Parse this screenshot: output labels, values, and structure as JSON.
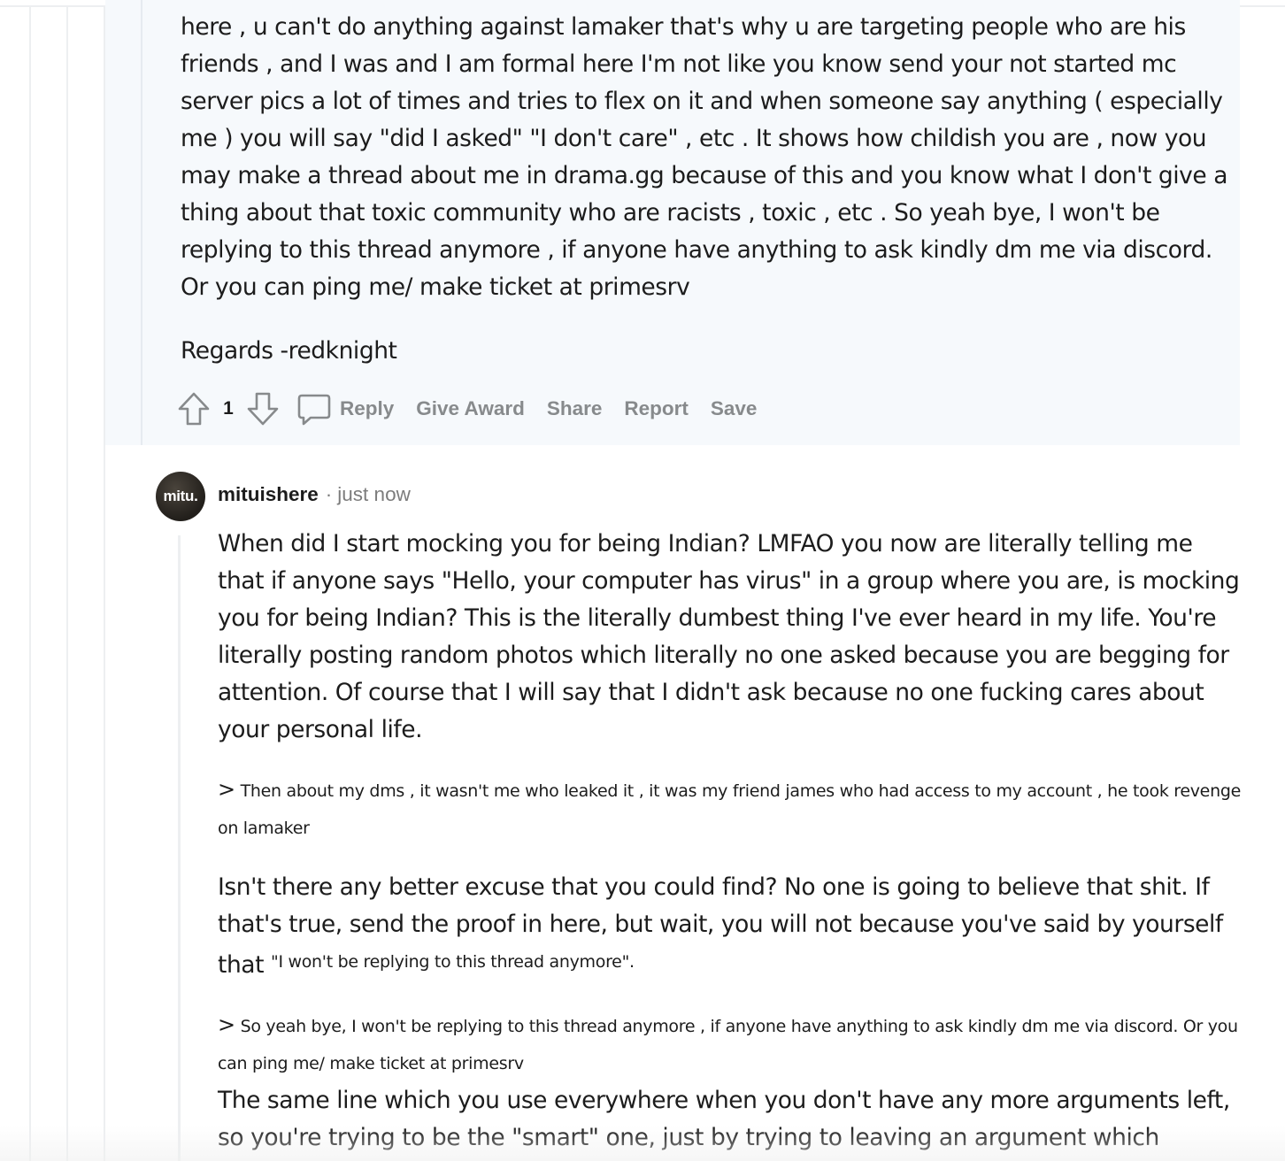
{
  "parent_comment": {
    "body_paragraph": "here , u can't do anything against lamaker that's why u are targeting people who are his friends , and I was and I am formal here I'm not like you know send your not started mc server pics a lot of times and tries to flex on it and when someone say anything ( especially me ) you will say \"did I asked\" \"I don't care\" , etc . It shows how childish you are , now you may make a thread about me in drama.gg because of this and you know what I don't give a thing about that toxic community who are racists , toxic , etc . So yeah bye, I won't be replying to this thread anymore , if anyone have anything to ask kindly dm me via discord. Or you can ping me/ make ticket at primesrv",
    "signoff": "Regards -redknight",
    "score": "1",
    "actions": {
      "reply": "Reply",
      "give_award": "Give Award",
      "share": "Share",
      "report": "Report",
      "save": "Save"
    }
  },
  "reply_comment": {
    "avatar_text": "mitu.",
    "username": "mituishere",
    "separator": "·",
    "timestamp": "just now",
    "p1": "When did I start mocking you for being Indian? LMFAO you now are literally telling me that if anyone says \"Hello, your computer has virus\" in a group where you are, is mocking you for being Indian? This is the literally dumbest thing I've ever heard in my life. You're literally posting random photos which literally no one asked because you are begging for attention. Of course that I will say that I didn't ask because no one fucking cares about your personal life.",
    "quote1_marker": ">",
    "quote1": "Then about my dms , it wasn't me who leaked it , it was my friend james who had access to my account , he took revenge on lamaker",
    "p2_main": "Isn't there any better excuse that you could find? No one is going to believe that shit. If that's true, send the proof in here, but wait, you will not because you've said by yourself that",
    "p2_small": "\"I won't be replying to this thread anymore\".",
    "quote2_marker": ">",
    "quote2": "So yeah bye, I won't be replying to this thread anymore , if anyone have anything to ask kindly dm me via discord. Or you can ping me/ make ticket at primesrv",
    "p3": "The same line which you use everywhere when you don't have any more arguments left, so you're trying to be the \"smart\" one, just by trying to leaving an argument which"
  },
  "colors": {
    "highlight_bg": "#f6f9fc",
    "action_gray": "#878a8c",
    "thread_line": "#edeff1",
    "text": "#1c1c1c"
  },
  "icons": [
    "upvote-icon",
    "downvote-icon",
    "comment-icon"
  ]
}
